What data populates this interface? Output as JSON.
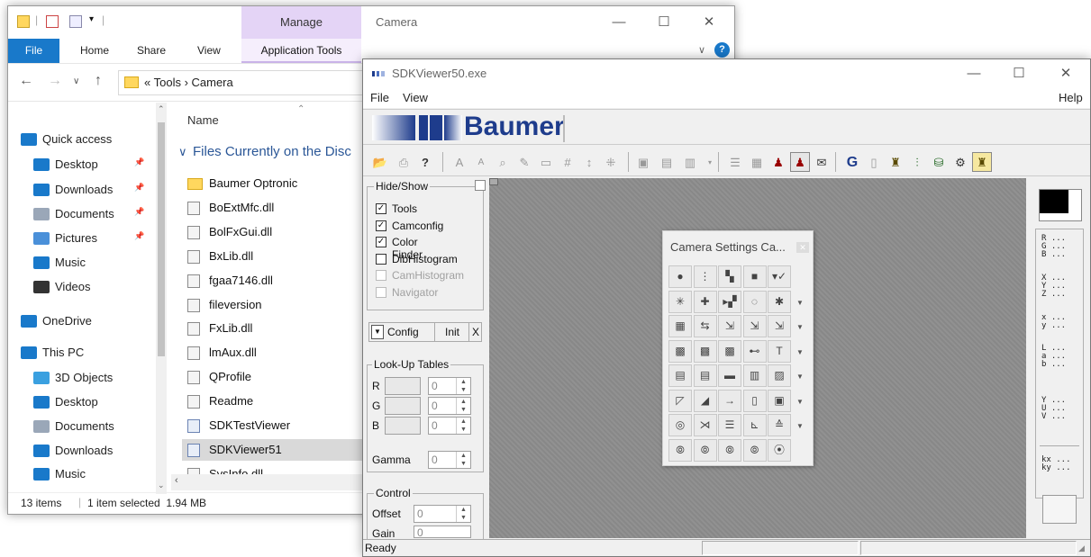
{
  "explorer": {
    "manage_tab": "Manage",
    "title": "Camera",
    "ribbon_tabs": {
      "file": "File",
      "home": "Home",
      "share": "Share",
      "view": "View",
      "app_tools": "Application Tools"
    },
    "address": "« Tools › Camera",
    "nav": [
      {
        "label": "Quick access",
        "icon": "star-icon"
      },
      {
        "label": "Desktop",
        "icon": "desktop-icon"
      },
      {
        "label": "Downloads",
        "icon": "download-icon"
      },
      {
        "label": "Documents",
        "icon": "documents-icon"
      },
      {
        "label": "Pictures",
        "icon": "pictures-icon"
      },
      {
        "label": "Music",
        "icon": "music-icon"
      },
      {
        "label": "Videos",
        "icon": "videos-icon"
      },
      {
        "label": "OneDrive",
        "icon": "cloud-icon"
      },
      {
        "label": "This PC",
        "icon": "pc-icon"
      },
      {
        "label": "3D Objects",
        "icon": "cube-icon"
      },
      {
        "label": "Desktop",
        "icon": "desktop-icon"
      },
      {
        "label": "Documents",
        "icon": "documents-icon"
      },
      {
        "label": "Downloads",
        "icon": "download-icon"
      },
      {
        "label": "Music",
        "icon": "music-icon"
      }
    ],
    "column_name": "Name",
    "group_header": "Files Currently on the Disc",
    "files": [
      {
        "name": "Baumer Optronic",
        "type": "folder"
      },
      {
        "name": "BoExtMfc.dll",
        "type": "dll"
      },
      {
        "name": "BolFxGui.dll",
        "type": "dll"
      },
      {
        "name": "BxLib.dll",
        "type": "dll"
      },
      {
        "name": "fgaa7146.dll",
        "type": "dll"
      },
      {
        "name": "fileversion",
        "type": "file"
      },
      {
        "name": "FxLib.dll",
        "type": "dll"
      },
      {
        "name": "lmAux.dll",
        "type": "dll"
      },
      {
        "name": "QProfile",
        "type": "file"
      },
      {
        "name": "Readme",
        "type": "file"
      },
      {
        "name": "SDKTestViewer",
        "type": "exe"
      },
      {
        "name": "SDKViewer51",
        "type": "exe",
        "selected": true
      },
      {
        "name": "SysInfo.dll",
        "type": "dll"
      }
    ],
    "status_items": "13 items",
    "status_selected": "1 item selected  1.94 MB"
  },
  "sdk": {
    "title": "SDKViewer50.exe",
    "menu": {
      "file": "File",
      "view": "View",
      "help": "Help"
    },
    "logo": "Baumer",
    "hide_show_title": "Hide/Show",
    "checkboxes": [
      {
        "label": "Tools",
        "checked": true,
        "enabled": true
      },
      {
        "label": "Camconfig",
        "checked": true,
        "enabled": true
      },
      {
        "label": "Color Finder",
        "checked": true,
        "enabled": true
      },
      {
        "label": "DibHistogram",
        "checked": false,
        "enabled": true
      },
      {
        "label": "CamHistogram",
        "checked": false,
        "enabled": false
      },
      {
        "label": "Navigator",
        "checked": false,
        "enabled": false
      }
    ],
    "config_label": "Config",
    "init_label": "Init",
    "close_glyph": "X",
    "lut_title": "Look-Up Tables",
    "lut": [
      {
        "ch": "R",
        "value": "0"
      },
      {
        "ch": "G",
        "value": "0"
      },
      {
        "ch": "B",
        "value": "0"
      }
    ],
    "gamma_label": "Gamma",
    "gamma_value": "0",
    "control_title": "Control",
    "offset_label": "Offset",
    "offset_value": "0",
    "gain_label": "Gain",
    "gain_value": "0",
    "palette_title": "Camera Settings Ca...",
    "readouts": [
      "R ...\nG ...\nB ...",
      "X ...\nY ...\nZ ...",
      "x ...\ny ...",
      "L ...\na ...\nb ...",
      "Y ...\nU ...\nV ...",
      "kx ...\nky ..."
    ],
    "status": "Ready",
    "toolbar_labels": {
      "g": "G"
    }
  },
  "colors": {
    "file_tab": "#1979ca",
    "manage_tab": "#e4d4f6",
    "logo": "#1e3c8c",
    "viewport": "#8d8d8d"
  }
}
